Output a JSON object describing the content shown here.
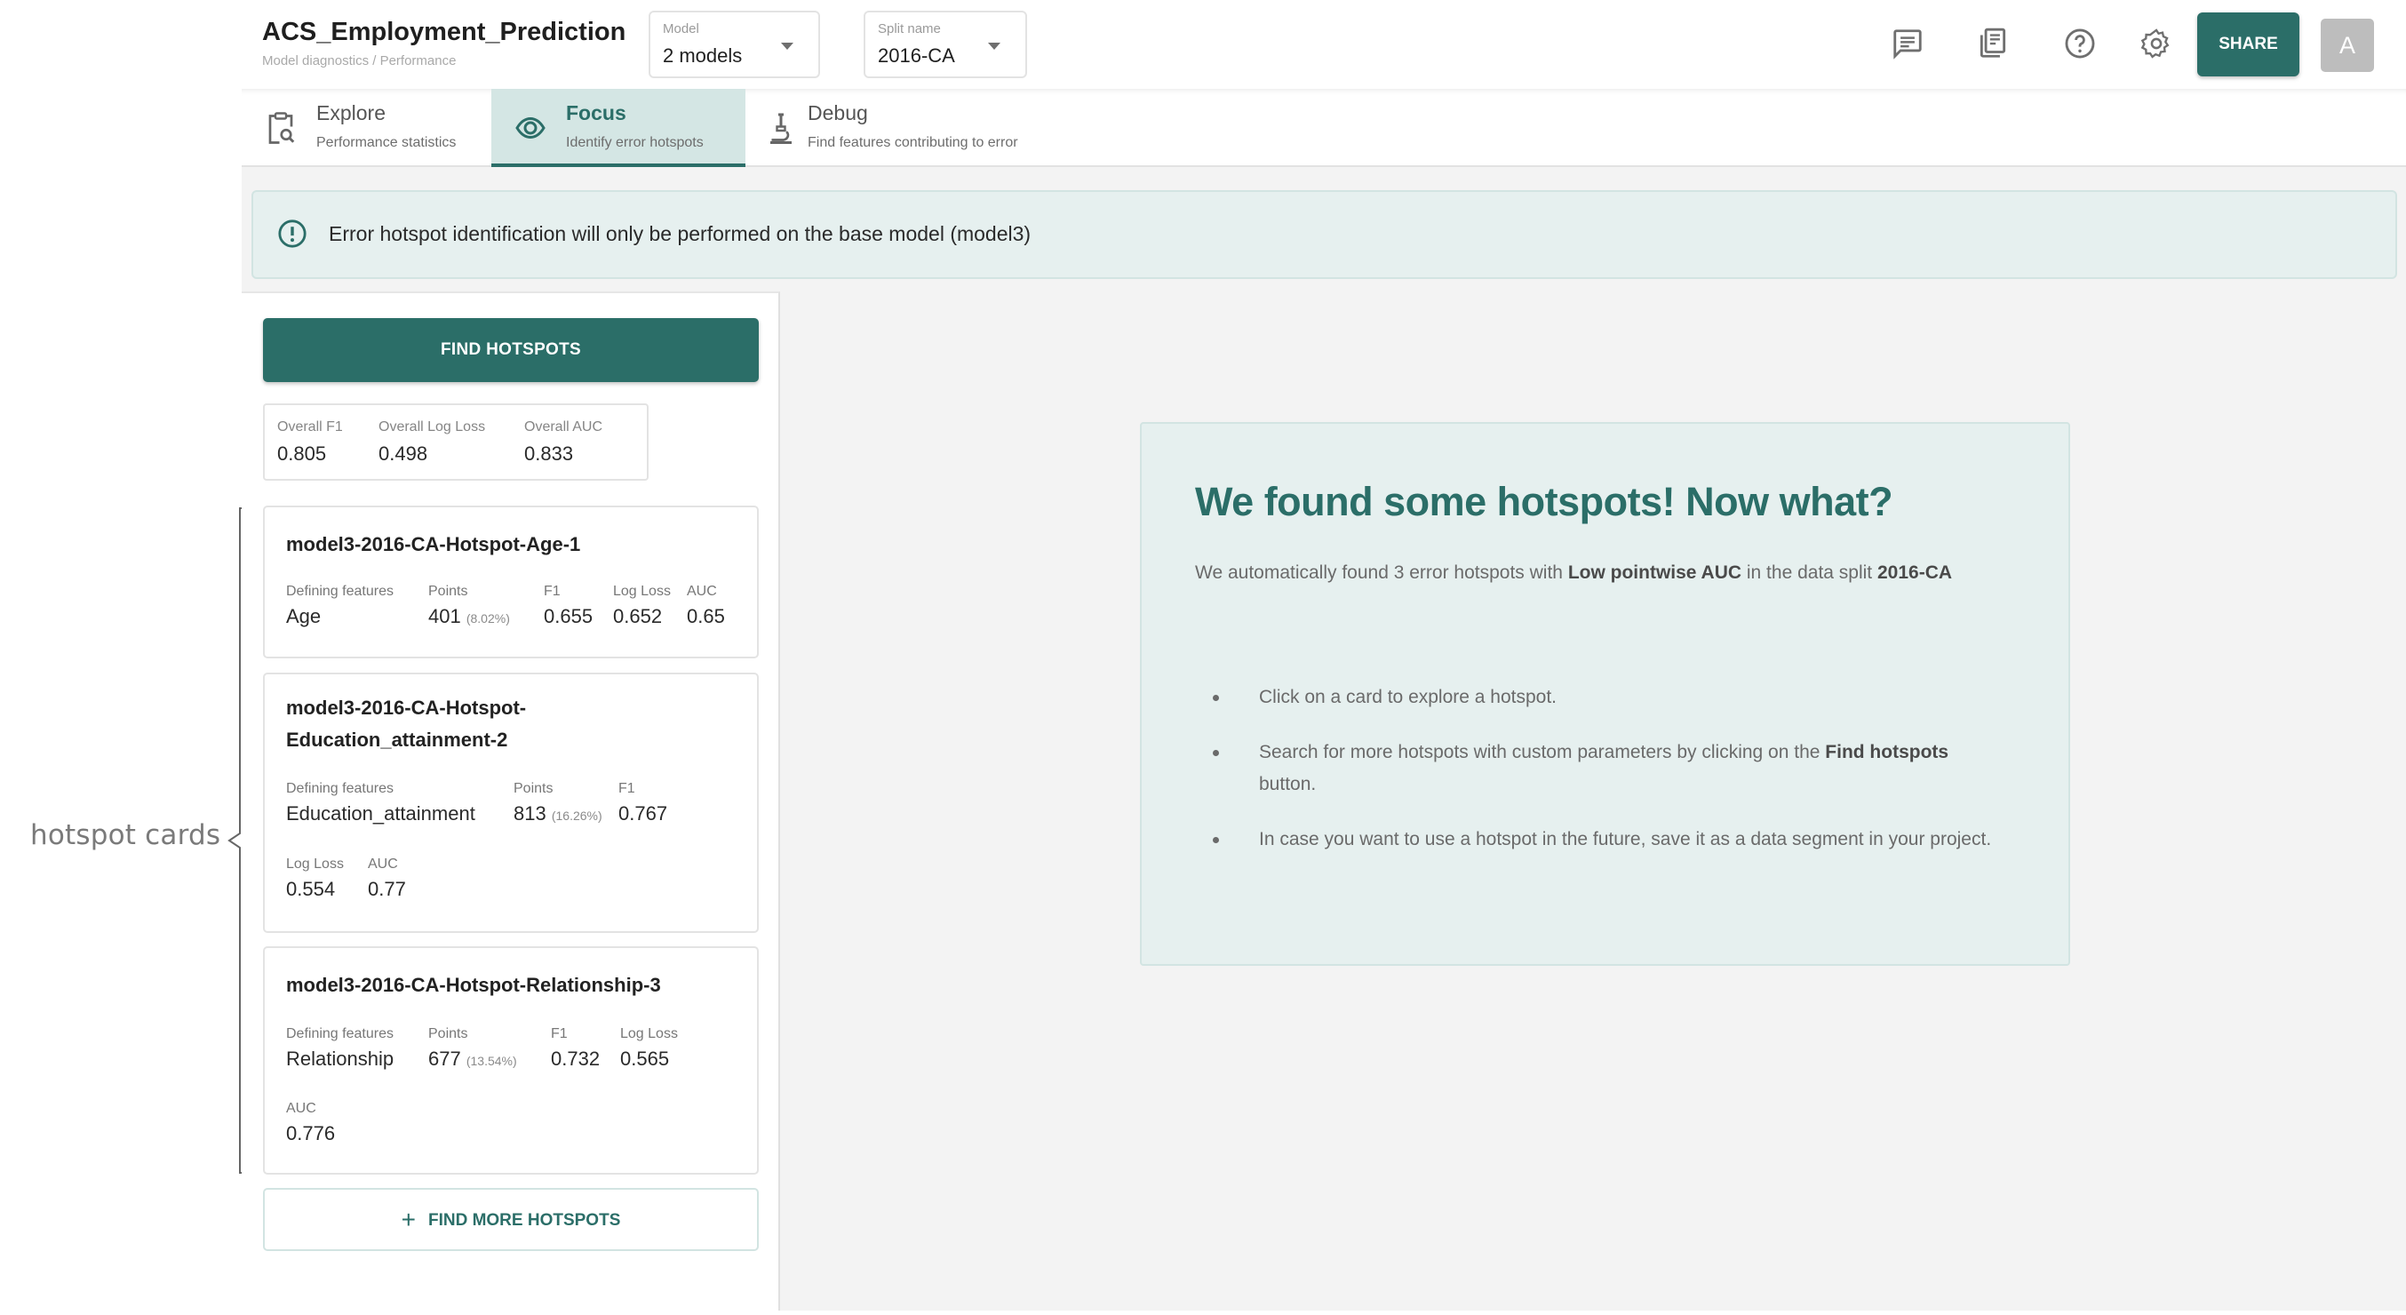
{
  "annotation": {
    "label": "hotspot cards"
  },
  "header": {
    "title": "ACS_Employment_Prediction",
    "breadcrumb": "Model diagnostics / Performance",
    "model_select": {
      "label": "Model",
      "value": "2 models"
    },
    "split_select": {
      "label": "Split name",
      "value": "2016-CA"
    },
    "icons": [
      "comments-icon",
      "documentation-icon",
      "help-icon",
      "settings-icon"
    ],
    "share_label": "SHARE",
    "avatar_initial": "A",
    "accent_color": "#2b6e68"
  },
  "tabs": [
    {
      "title": "Explore",
      "subtitle": "Performance statistics",
      "icon": "clipboard-search-icon",
      "active": false
    },
    {
      "title": "Focus",
      "subtitle": "Identify error hotspots",
      "icon": "eye-icon",
      "active": true
    },
    {
      "title": "Debug",
      "subtitle": "Find features contributing to error",
      "icon": "microscope-icon",
      "active": false
    }
  ],
  "alert": {
    "icon": "info-circle-icon",
    "text": "Error hotspot identification will only be performed on the base model (model3)"
  },
  "left_panel": {
    "find_button": "FIND HOTSPOTS",
    "overall": [
      {
        "label": "Overall F1",
        "value": "0.805"
      },
      {
        "label": "Overall Log Loss",
        "value": "0.498"
      },
      {
        "label": "Overall AUC",
        "value": "0.833"
      }
    ],
    "cards": [
      {
        "title": "model3-2016-CA-Hotspot-Age-1",
        "defining_features_label": "Defining features",
        "defining_features": "Age",
        "points_label": "Points",
        "points": "401",
        "points_pct": "(8.02%)",
        "f1_label": "F1",
        "f1": "0.655",
        "logloss_label": "Log Loss",
        "logloss": "0.652",
        "auc_label": "AUC",
        "auc": "0.65"
      },
      {
        "title_line1": "model3-2016-CA-Hotspot-",
        "title_line2": "Education_attainment-2",
        "defining_features_label": "Defining features",
        "defining_features": "Education_attainment",
        "points_label": "Points",
        "points": "813",
        "points_pct": "(16.26%)",
        "f1_label": "F1",
        "f1": "0.767",
        "logloss_label": "Log Loss",
        "logloss": "0.554",
        "auc_label": "AUC",
        "auc": "0.77"
      },
      {
        "title": "model3-2016-CA-Hotspot-Relationship-3",
        "defining_features_label": "Defining features",
        "defining_features": "Relationship",
        "points_label": "Points",
        "points": "677",
        "points_pct": "(13.54%)",
        "f1_label": "F1",
        "f1": "0.732",
        "logloss_label": "Log Loss",
        "logloss": "0.565",
        "auc_label": "AUC",
        "auc": "0.776"
      }
    ],
    "find_more_button": "FIND MORE HOTSPOTS"
  },
  "info": {
    "title": "We found some hotspots! Now what?",
    "desc_pre": "We automatically found 3 error hotspots with ",
    "desc_bold": "Low pointwise AUC",
    "desc_mid": " in the data split ",
    "desc_split": "2016-CA",
    "bullets": [
      {
        "pre": "Click on a card to explore a hotspot.",
        "bold": "",
        "post": ""
      },
      {
        "pre": "Search for more hotspots with custom parameters by clicking on the ",
        "bold": "Find hotspots",
        "post": " button."
      },
      {
        "pre": "In case you want to use a hotspot in the future, save it as a data segment in your project.",
        "bold": "",
        "post": ""
      }
    ]
  }
}
